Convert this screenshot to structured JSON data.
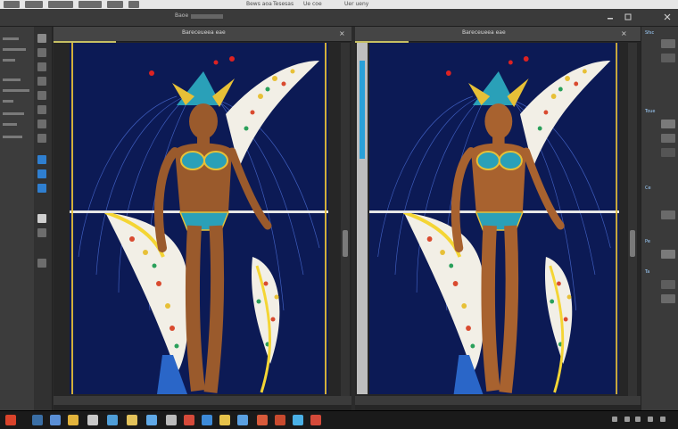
{
  "menubar": {
    "center_items": [
      "Bews aoa",
      "Tesesas",
      "Ue coe",
      "Uer ueny"
    ],
    "menu_item_count": 6
  },
  "options": {
    "left_title": "Baoe"
  },
  "documents": [
    {
      "tab_label": "Bareceueea eae",
      "close_glyph": "×"
    },
    {
      "tab_label": "Bareceueea eae",
      "close_glyph": "×"
    }
  ],
  "right_panel": {
    "header_label": "Sfsc",
    "labels": [
      "Toue",
      "Ce",
      "Pe",
      "Ta"
    ]
  },
  "colors": {
    "canvas_bg": "#0c1a55",
    "skin": "#9a5a2c",
    "costume_teal": "#2aa0b8",
    "costume_gold": "#e7c037",
    "wing_white": "#f2efe6",
    "accent_yellow": "#f4d534",
    "taskbar_bg": "#1a1a1a"
  },
  "icons": {
    "close": "close-icon",
    "minimize": "minimize-icon",
    "maximize": "maximize-icon",
    "start": "windows-start-icon"
  }
}
